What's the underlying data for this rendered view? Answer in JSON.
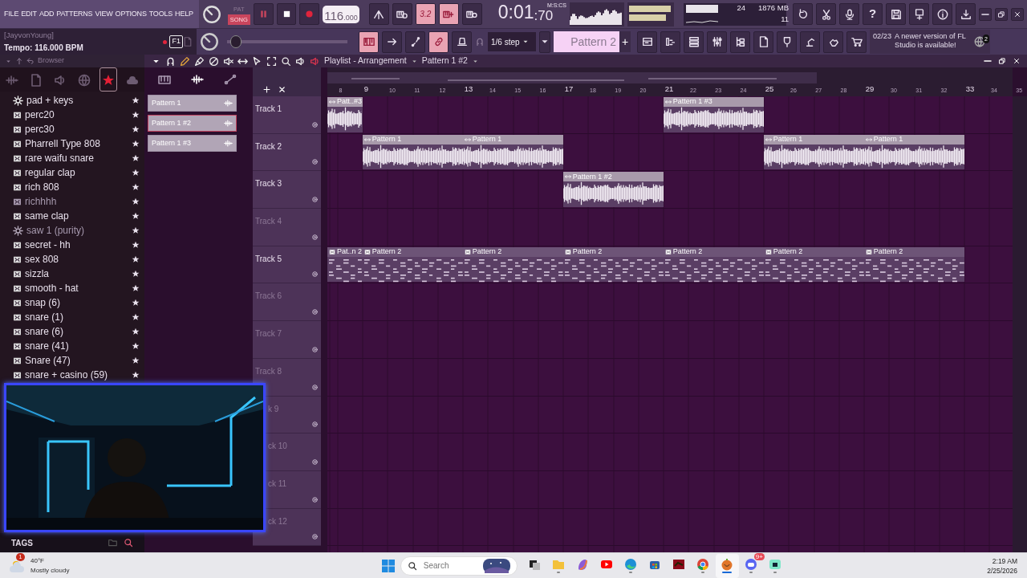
{
  "menu": [
    "FILE",
    "EDIT",
    "ADD",
    "PATTERNS",
    "VIEW",
    "OPTIONS",
    "TOOLS",
    "HELP"
  ],
  "transport": {
    "modes": [
      {
        "label": "PAT",
        "selected": false
      },
      {
        "label": "SONG",
        "selected": true
      }
    ],
    "tempo": "116",
    "tempo_fraction": ".000"
  },
  "toggles": [
    {
      "kind": "icon",
      "on": false
    },
    {
      "kind": "icon",
      "on": false
    },
    {
      "kind": "text",
      "label": "3.2",
      "on": true
    },
    {
      "kind": "icon",
      "on": true
    },
    {
      "kind": "icon",
      "on": false
    }
  ],
  "time": {
    "value": "0:01",
    "fraction": ":70",
    "unit": "M:S:CS"
  },
  "cpu": {
    "voices": "24",
    "memory": "1876 MB",
    "polyphony": "11"
  },
  "tools": [
    {
      "kind": "icon"
    },
    {
      "kind": "icon"
    },
    {
      "kind": "icon"
    },
    {
      "kind": "text",
      "label": "?"
    },
    {
      "kind": "icon"
    },
    {
      "kind": "icon"
    },
    {
      "kind": "icon"
    },
    {
      "kind": "icon"
    }
  ],
  "hint": {
    "user": "[JayvonYoung]",
    "text": "Tempo: 116.000 BPM",
    "key": "F1"
  },
  "pitch": {
    "level": 0.03
  },
  "toggles2": [
    {
      "on": true
    },
    {
      "on": false
    },
    {
      "on": false
    },
    {
      "on": true
    },
    {
      "on": false
    }
  ],
  "snap": "1/6 step",
  "pattern_selector": {
    "value": "Pattern 2",
    "add": "+"
  },
  "news": {
    "date": "02/23",
    "text": "A newer version of FL Studio is available!",
    "count": "2"
  },
  "browser": {
    "title": "Browser",
    "tabs": [
      {
        "selected": false
      },
      {
        "selected": false
      },
      {
        "selected": false
      },
      {
        "selected": false
      },
      {
        "selected": true
      },
      {
        "selected": false
      }
    ],
    "items": [
      {
        "name": "pad + keys",
        "kind": "plugin",
        "dimmed": false
      },
      {
        "name": "perc20",
        "kind": "pattern",
        "dimmed": false
      },
      {
        "name": "perc30",
        "kind": "pattern",
        "dimmed": false
      },
      {
        "name": "Pharrell Type 808",
        "kind": "pattern",
        "dimmed": false
      },
      {
        "name": "rare waifu snare",
        "kind": "pattern",
        "dimmed": false
      },
      {
        "name": "regular clap",
        "kind": "pattern",
        "dimmed": false
      },
      {
        "name": "rich 808",
        "kind": "pattern",
        "dimmed": false
      },
      {
        "name": "richhhh",
        "kind": "pattern",
        "dimmed": true
      },
      {
        "name": "same clap",
        "kind": "pattern",
        "dimmed": false
      },
      {
        "name": "saw 1 (purity)",
        "kind": "plugin",
        "dimmed": true
      },
      {
        "name": "secret - hh",
        "kind": "pattern",
        "dimmed": false
      },
      {
        "name": "sex 808",
        "kind": "pattern",
        "dimmed": false
      },
      {
        "name": "sizzla",
        "kind": "pattern",
        "dimmed": false
      },
      {
        "name": "smooth - hat",
        "kind": "pattern",
        "dimmed": false
      },
      {
        "name": "snap (6)",
        "kind": "pattern",
        "dimmed": false
      },
      {
        "name": "snare (1)",
        "kind": "pattern",
        "dimmed": false
      },
      {
        "name": "snare (6)",
        "kind": "pattern",
        "dimmed": false
      },
      {
        "name": "snare (41)",
        "kind": "pattern",
        "dimmed": false
      },
      {
        "name": "Snare (47)",
        "kind": "pattern",
        "dimmed": false
      },
      {
        "name": "snare + casino (59)",
        "kind": "pattern",
        "dimmed": false
      }
    ],
    "footer": "TAGS"
  },
  "playlist": {
    "title": "Playlist - Arrangement",
    "pattern": "Pattern 1 #2",
    "patterns": [
      {
        "label": "Pattern 1",
        "selected": false
      },
      {
        "label": "Pattern 1 #2",
        "selected": true
      },
      {
        "label": "Pattern 1 #3",
        "selected": false
      }
    ],
    "ruler": [
      "8",
      "9",
      "10",
      "11",
      "12",
      "13",
      "14",
      "15",
      "16",
      "17",
      "18",
      "19",
      "20",
      "21",
      "22",
      "23",
      "24",
      "25",
      "26",
      "27",
      "28",
      "29",
      "30",
      "31",
      "32",
      "33",
      "34",
      "35"
    ],
    "tracks": [
      {
        "name": "Track 1",
        "dimmed": false,
        "cut": false,
        "clips": [
          {
            "label": "Patt..#3",
            "kind": "audio"
          },
          {
            "label": "Pattern 1 #3",
            "kind": "audio"
          }
        ]
      },
      {
        "name": "Track 2",
        "dimmed": false,
        "cut": false,
        "clips": [
          {
            "label": "Pattern 1",
            "kind": "audio"
          },
          {
            "label": "Pattern 1",
            "kind": "audio"
          },
          {
            "label": "Pattern 1",
            "kind": "audio"
          },
          {
            "label": "Pattern 1",
            "kind": "audio"
          }
        ]
      },
      {
        "name": "Track 3",
        "dimmed": false,
        "cut": false,
        "clips": [
          {
            "label": "Pattern 1 #2",
            "kind": "audio"
          }
        ]
      },
      {
        "name": "Track 4",
        "dimmed": true,
        "cut": false
      },
      {
        "name": "Track 5",
        "dimmed": false,
        "cut": false,
        "clips": [
          {
            "label": "Pat..n 2",
            "kind": "notes"
          },
          {
            "label": "Pattern 2",
            "kind": "notes"
          },
          {
            "label": "Pattern 2",
            "kind": "notes"
          },
          {
            "label": "Pattern 2",
            "kind": "notes"
          },
          {
            "label": "Pattern 2",
            "kind": "notes"
          },
          {
            "label": "Pattern 2",
            "kind": "notes"
          },
          {
            "label": "Pattern 2",
            "kind": "notes"
          }
        ]
      },
      {
        "name": "Track 6",
        "dimmed": true,
        "cut": false
      },
      {
        "name": "Track 7",
        "dimmed": true,
        "cut": false
      },
      {
        "name": "Track 8",
        "dimmed": true,
        "cut": false
      },
      {
        "name": "k 9",
        "dimmed": true,
        "cut": true
      },
      {
        "name": "ck 10",
        "dimmed": true,
        "cut": true
      },
      {
        "name": "ck 11",
        "dimmed": true,
        "cut": true
      },
      {
        "name": "ck 12",
        "dimmed": true,
        "cut": true
      }
    ]
  },
  "taskbar": {
    "weather": {
      "temp": "40°F",
      "desc": "Mostly cloudy",
      "badge": "1"
    },
    "search": {
      "placeholder": "Search"
    },
    "apps": [
      {
        "running": false,
        "active": false
      },
      {
        "running": true,
        "active": false
      },
      {
        "running": false,
        "active": false
      },
      {
        "running": false,
        "active": false
      },
      {
        "running": true,
        "active": false
      },
      {
        "running": false,
        "active": false
      },
      {
        "running": false,
        "active": false
      },
      {
        "running": true,
        "active": false
      },
      {
        "running": true,
        "active": true
      },
      {
        "running": true,
        "active": false,
        "badge": "9+"
      },
      {
        "running": true,
        "active": false
      }
    ],
    "time": "2:19 AM",
    "date": "2/25/2026"
  }
}
